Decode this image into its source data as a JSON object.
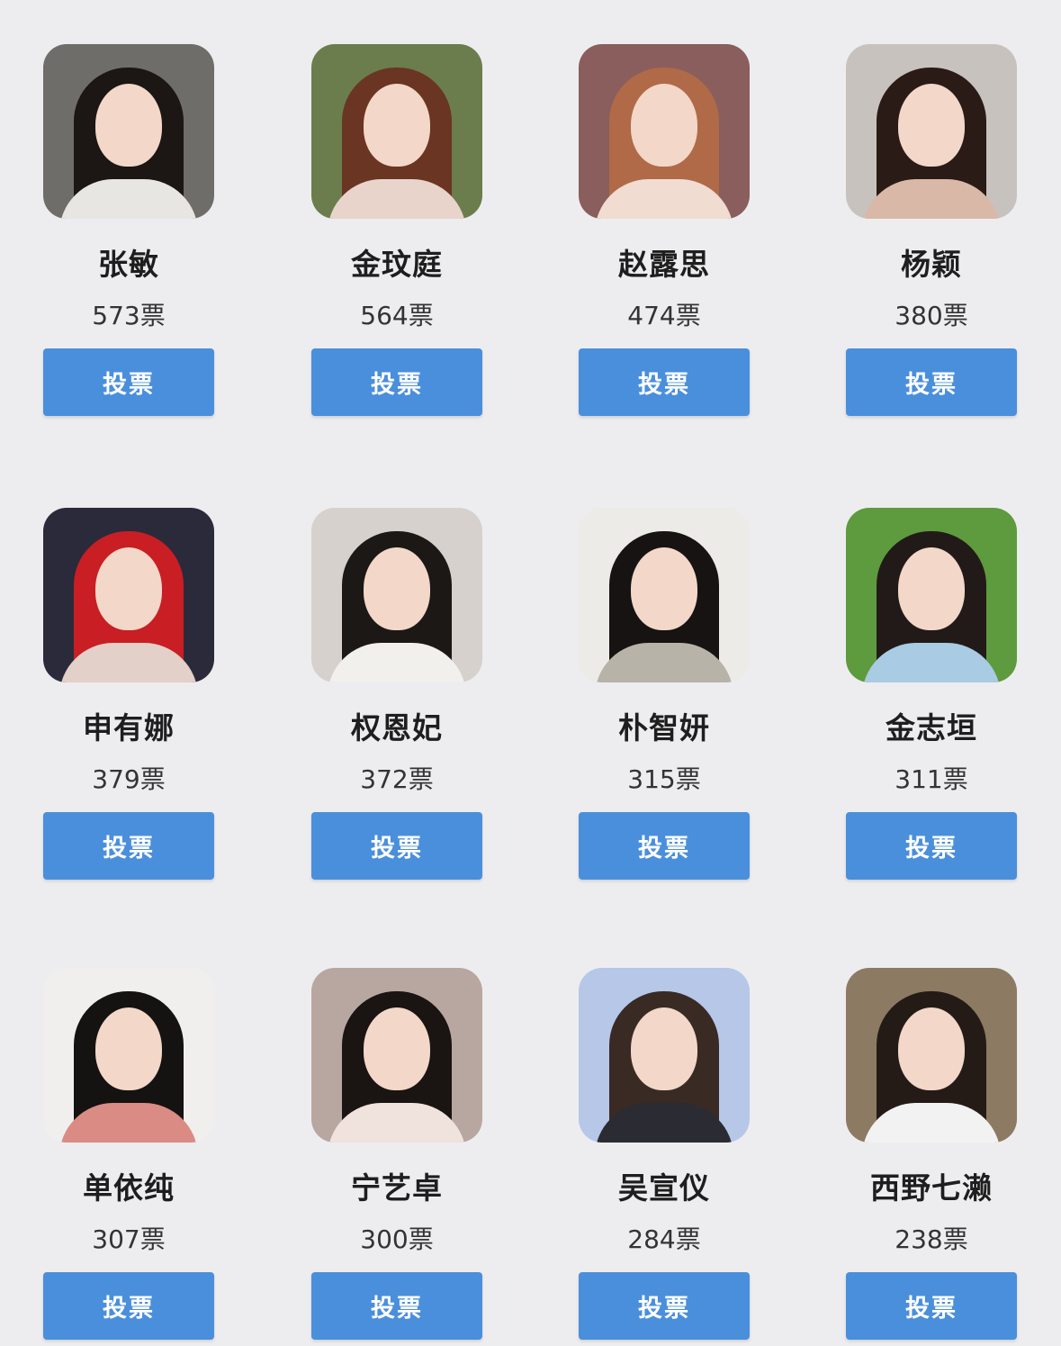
{
  "vote_button_label": "投票",
  "candidates": [
    {
      "name": "张敏",
      "votes": "573票",
      "bg": "#6f6d6a",
      "hair": "#1c1614",
      "outfit": "#e8e6e2"
    },
    {
      "name": "金玟庭",
      "votes": "564票",
      "bg": "#6b7d4c",
      "hair": "#6a3522",
      "outfit": "#e9d4cc"
    },
    {
      "name": "赵露思",
      "votes": "474票",
      "bg": "#8a5e5c",
      "hair": "#b06a48",
      "outfit": "#f1dcd2"
    },
    {
      "name": "杨颖",
      "votes": "380票",
      "bg": "#c8c2bf",
      "hair": "#2a1b16",
      "outfit": "#d9b8a8"
    },
    {
      "name": "申有娜",
      "votes": "379票",
      "bg": "#2a2a3a",
      "hair": "#c81e24",
      "outfit": "#e3d0c8"
    },
    {
      "name": "权恩妃",
      "votes": "372票",
      "bg": "#d6d1cc",
      "hair": "#1c1816",
      "outfit": "#f2f0ec"
    },
    {
      "name": "朴智妍",
      "votes": "315票",
      "bg": "#ecebe8",
      "hair": "#171313",
      "outfit": "#b7b3a8"
    },
    {
      "name": "金志垣",
      "votes": "311票",
      "bg": "#5e9a3e",
      "hair": "#221a18",
      "outfit": "#a9cbe3"
    },
    {
      "name": "单依纯",
      "votes": "307票",
      "bg": "#f1efed",
      "hair": "#151212",
      "outfit": "#d98b84"
    },
    {
      "name": "宁艺卓",
      "votes": "300票",
      "bg": "#b8a7a0",
      "hair": "#1a1412",
      "outfit": "#f0e2dc"
    },
    {
      "name": "吴宣仪",
      "votes": "284票",
      "bg": "#b6c7e8",
      "hair": "#3a2a24",
      "outfit": "#2b2b33"
    },
    {
      "name": "西野七濑",
      "votes": "238票",
      "bg": "#8c7a62",
      "hair": "#241b17",
      "outfit": "#f2f2f2"
    }
  ]
}
